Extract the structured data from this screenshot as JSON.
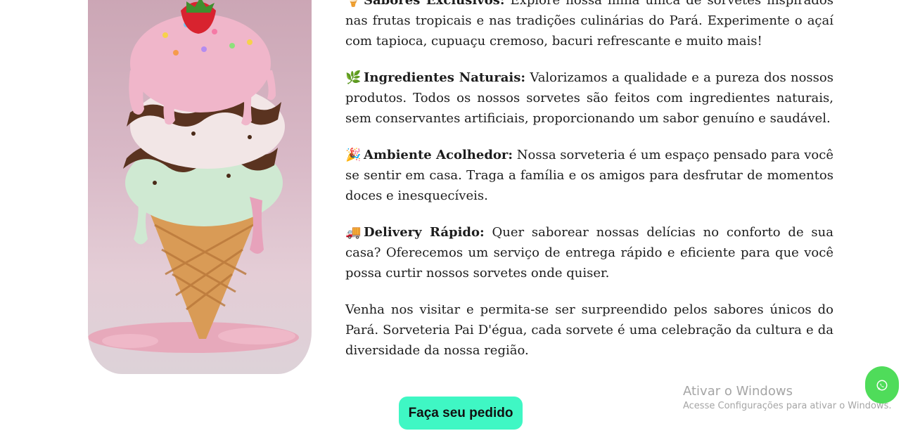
{
  "features": [
    {
      "icon": "ice-cream-icon",
      "glyph": "🍦",
      "title": "Sabores Exclusivos:",
      "text": " Explore nossa linha única de sorvetes inspirados nas frutas tropicais e nas tradições culinárias do Pará. Experimente o açaí com tapioca, cupuaçu cremoso, bacuri refrescante e muito mais!"
    },
    {
      "icon": "leaf-icon",
      "glyph": "🌿",
      "title": "Ingredientes Naturais:",
      "text": " Valorizamos a qualidade e a pureza dos nossos produtos. Todos os nossos sorvetes são feitos com ingredientes naturais, sem conservantes artificiais, proporcionando um sabor genuíno e saudável."
    },
    {
      "icon": "party-popper-icon",
      "glyph": "🎉",
      "title": "Ambiente Acolhedor:",
      "text": " Nossa sorveteria é um espaço pensado para você se sentir em casa. Traga a família e os amigos para desfrutar de momentos doces e inesquecíveis."
    },
    {
      "icon": "delivery-truck-icon",
      "glyph": "🚚",
      "title": "Delivery Rápido:",
      "text": " Quer saborear nossas delícias no conforto de sua casa? Oferecemos um serviço de entrega rápido e eficiente para que você possa curtir nossos sorvetes onde quiser."
    }
  ],
  "closing": "Venha nos visitar e permita-se ser surpreendido pelos sabores únicos do Pará. Sorveteria Pai D'égua, cada sorvete é uma celebração da cultura e da diversidade da nossa região.",
  "order_button": "Faça seu pedido",
  "watermark": {
    "title": "Ativar o Windows",
    "subtitle": "Acesse Configurações para ativar o Windows."
  },
  "whatsapp_icon": "whatsapp-icon",
  "colors": {
    "button": "#3ff7c4",
    "whatsapp": "#4fdc5a"
  }
}
